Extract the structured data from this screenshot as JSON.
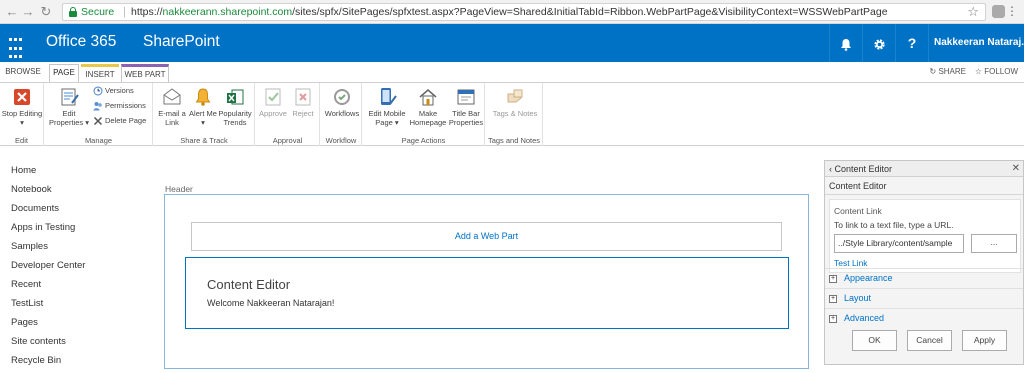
{
  "browser": {
    "secure_label": "Secure",
    "url_scheme": "https://",
    "url_domain": "nakkeerann.sharepoint.com",
    "url_path": "/sites/spfx/SitePages/spfxtest.aspx?PageView=Shared&InitialTabId=Ribbon.WebPartPage&VisibilityContext=WSSWebPartPage"
  },
  "suitebar": {
    "brand": "Office 365",
    "app": "SharePoint",
    "user": "Nakkeeran Nataraj..."
  },
  "ribbon_tabs": {
    "browse": "BROWSE",
    "page": "PAGE",
    "insert": "INSERT",
    "webpart": "WEB PART",
    "share": "SHARE",
    "follow": "FOLLOW"
  },
  "ribbon": {
    "edit": {
      "label": "Edit",
      "stop_editing": "Stop Editing"
    },
    "manage": {
      "label": "Manage",
      "edit_properties": "Edit Properties",
      "versions": "Versions",
      "permissions": "Permissions",
      "delete_page": "Delete Page"
    },
    "share_track": {
      "label": "Share & Track",
      "email_link": "E-mail a Link",
      "alert_me": "Alert Me",
      "popularity_trends": "Popularity Trends"
    },
    "approval": {
      "label": "Approval",
      "approve": "Approve",
      "reject": "Reject"
    },
    "workflow": {
      "label": "Workflow",
      "workflows": "Workflows"
    },
    "page_actions": {
      "label": "Page Actions",
      "edit_mobile_page": "Edit Mobile Page",
      "make_homepage": "Make Homepage",
      "title_bar_properties": "Title Bar Properties"
    },
    "tags_notes": {
      "label": "Tags and Notes",
      "tags_notes": "Tags & Notes"
    }
  },
  "leftnav": [
    "Home",
    "Notebook",
    "Documents",
    "Apps in Testing",
    "Samples",
    "Developer Center",
    "Recent",
    "TestList",
    "Pages",
    "Site contents",
    "Recycle Bin"
  ],
  "zone": {
    "label": "Header",
    "add_webpart": "Add a Web Part",
    "cewp_title": "Content Editor",
    "cewp_body": "Welcome Nakkeeran Natarajan!"
  },
  "toolpane": {
    "header": "Content Editor",
    "subheader": "Content Editor",
    "content_link_label": "Content Link",
    "hint": "To link to a text file, type a URL.",
    "input_value": "../Style Library/content/sample",
    "browse": "...",
    "test_link": "Test Link",
    "sections": [
      "Appearance",
      "Layout",
      "Advanced"
    ],
    "ok": "OK",
    "cancel": "Cancel",
    "apply": "Apply"
  },
  "colors": {
    "suite_blue": "#0072c6",
    "secure_green": "#1a8a3c",
    "insert_tab": "#e6c84b",
    "webpart_tab": "#8a64b4"
  }
}
